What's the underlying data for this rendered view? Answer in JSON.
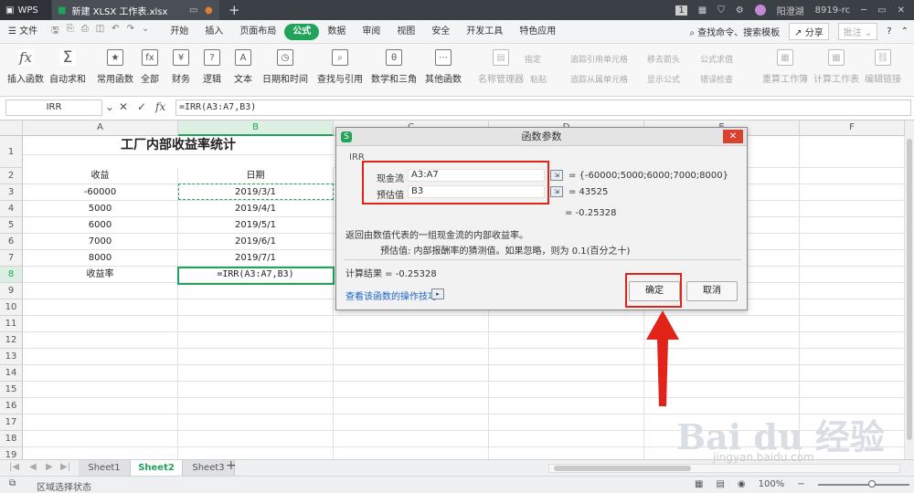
{
  "titlebar": {
    "app": "WPS",
    "tab_name": "新建 XLSX 工作表.xlsx",
    "plus": "+",
    "badge": "1",
    "user": "阳澄湖",
    "version": "8919-rc",
    "minimize": "─",
    "restore": "▭",
    "close": "✕"
  },
  "menubar": {
    "file": "文件",
    "items": [
      "开始",
      "插入",
      "页面布局",
      "公式",
      "数据",
      "审阅",
      "视图",
      "安全",
      "开发工具",
      "特色应用"
    ],
    "active_index": 3,
    "search": "查找命令、搜索模板",
    "share": "分享",
    "comment": "批注"
  },
  "ribbon": {
    "buttons": [
      "插入函数",
      "自动求和",
      "常用函数",
      "全部",
      "财务",
      "逻辑",
      "文本",
      "日期和时间",
      "查找与引用",
      "数学和三角",
      "其他函数"
    ],
    "gray_buttons": [
      "名称管理器",
      "粘贴"
    ],
    "small_left": [
      "指定",
      "追踪引用单元格",
      "追踪从属单元格"
    ],
    "small_mid": [
      "移去箭头",
      "显示公式",
      "公式求值",
      "错误检查"
    ],
    "right_buttons": [
      "重算工作簿",
      "计算工作表",
      "编辑链接"
    ]
  },
  "formulabar": {
    "namebox": "IRR",
    "cancel": "✕",
    "enter": "✓",
    "fx": "fx",
    "formula": "=IRR(A3:A7,B3)"
  },
  "grid": {
    "columns": [
      "A",
      "B",
      "C",
      "D",
      "E",
      "F"
    ],
    "rows": [
      "1",
      "2",
      "3",
      "4",
      "5",
      "6",
      "7",
      "8",
      "9",
      "10",
      "11",
      "12",
      "13",
      "14",
      "15",
      "16",
      "17",
      "18",
      "19"
    ],
    "title": "工厂内部收益率统计",
    "header_a": "收益",
    "header_b": "日期",
    "values": [
      "-60000",
      "5000",
      "6000",
      "7000",
      "8000"
    ],
    "dates": [
      "2019/3/1",
      "2019/4/1",
      "2019/5/1",
      "2019/6/1",
      "2019/7/1"
    ],
    "label_a8": "收益率",
    "formula_b8": "=IRR(A3:A7,B3)"
  },
  "sheets": [
    "Sheet1",
    "Sheet2",
    "Sheet3"
  ],
  "active_sheet_index": 1,
  "statusbar": {
    "status": "区域选择状态",
    "zoom": "100%"
  },
  "dialog": {
    "title": "函数参数",
    "function_name": "IRR",
    "arg1_label": "现金流",
    "arg1_value": "A3:A7",
    "arg1_result": "= {-60000;5000;6000;7000;8000}",
    "arg2_label": "预估值",
    "arg2_value": "B3",
    "arg2_result": "= 43525",
    "result_line": "= -0.25328",
    "description": "返回由数值代表的一组现金流的内部收益率。",
    "param_desc": "预估值:  内部报酬率的猜测值。如果忽略，则为 0.1(百分之十)",
    "calc_result": "计算结果 = -0.25328",
    "help_link": "查看该函数的操作技巧",
    "ok": "确定",
    "cancel": "取消"
  },
  "watermark": {
    "text": "Bai du 经验",
    "sub": "jingyan.baidu.com"
  },
  "colors": {
    "accent": "#21a45a",
    "annotation_red": "#e2231a"
  }
}
